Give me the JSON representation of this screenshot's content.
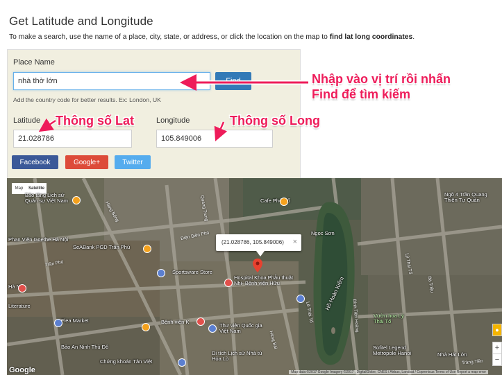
{
  "page": {
    "title": "Get Latitude and Longitude",
    "intro_prefix": "To make a search, use the name of a place, city, state, or address, or click the location on the map to ",
    "intro_bold": "find lat long coordinates",
    "intro_suffix": "."
  },
  "search": {
    "label": "Place Name",
    "value": "nhà thờ lớn",
    "find_label": "Find",
    "hint": "Add the country code for better results. Ex: London, UK"
  },
  "coords": {
    "lat_label": "Latitude",
    "lat_value": "21.028786",
    "lng_label": "Longitude",
    "lng_value": "105.849006"
  },
  "share": {
    "facebook": "Facebook",
    "google": "Google+",
    "twitter": "Twitter"
  },
  "colors": {
    "facebook": "#3b5998",
    "google": "#dd4b39",
    "twitter": "#55acee",
    "find": "#337ab7",
    "annotation": "#ee1c5a",
    "panel_bg": "#f1efe0"
  },
  "map": {
    "tab_map": "Map",
    "tab_satellite": "Satellite",
    "infowindow": "(21.028786, 105.849006)",
    "infowindow_close": "×",
    "logo": "Google",
    "copyright": "Map data ©2017 Google Imagery ©2017 , DigitalGlobe, CNES / Airbus, Landsat / Copernicus  Terms of Use  Report a map error",
    "zoom_in": "+",
    "zoom_out": "−",
    "places": [
      "Bảo tàng Lịch sử Quân sự Việt Nam",
      "Phan Viện Goethe Hà Nội",
      "SeABank PGD Trần Phú",
      "Sportsware Store",
      "Hospital Khoa Phẫu thuật Nhi- Bệnh viện Hữu",
      "Cafe Phố Cổ",
      "Ngọc Sơn",
      "Hồ Hoàn Kiếm",
      "Flea Market",
      "Bệnh viện K",
      "Thư viện Quốc gia Việt Nam",
      "Bảo An Ninh Thủ Đô",
      "Chứng khoán Tân Việt",
      "Di tích Lịch sử Nhà tù Hỏa Lò",
      "Sofitel Legend Metropole Hanoi",
      "Vườn hoa Lý Thái Tổ",
      "Nhà Hát Lớn",
      "Ngõ 4 Trần Quang Thiện Tự Quán",
      "Literature",
      "Hà Nội"
    ],
    "streets": [
      "Hàng Bông",
      "Trần Phú",
      "Điện Biên Phủ",
      "Quang Trung",
      "Lê Thái Tổ",
      "Đinh Tiên Hoàng",
      "Hàng Bài",
      "Bà Triệu",
      "Lý Thái Tổ",
      "Tràng Tiền"
    ]
  },
  "annotations": {
    "find_note_line1": "Nhập vào vị trí rồi nhấn",
    "find_note_line2": "Find để tìm kiếm",
    "lat_note": "Thông số Lat",
    "long_note": "Thông số Long"
  }
}
